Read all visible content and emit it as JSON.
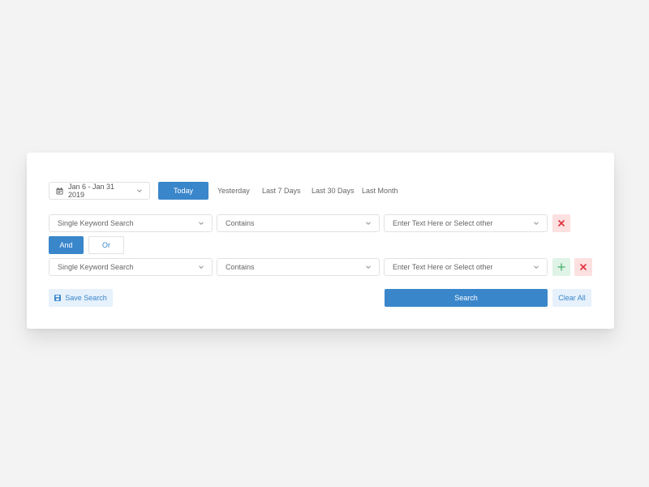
{
  "colors": {
    "accent": "#3a86cb",
    "accent_light": "#e6f1fb",
    "danger": "#e0303a",
    "danger_light": "#fde0e0",
    "success": "#46b06a",
    "success_light": "#dff3e6",
    "background": "#f3f3f3",
    "panel": "#ffffff"
  },
  "date_filter": {
    "range_label": "Jan 6 - Jan 31 2019",
    "icon": "calendar-icon",
    "quick_ranges": [
      {
        "label": "Today",
        "active": true
      },
      {
        "label": "Yesterday",
        "active": false
      },
      {
        "label": "Last 7 Days",
        "active": false
      },
      {
        "label": "Last 30 Days",
        "active": false
      },
      {
        "label": "Last Month",
        "active": false
      }
    ]
  },
  "conditions": [
    {
      "field": "Single Keyword Search",
      "operator": "Contains",
      "value_placeholder": "Enter Text Here or Select other",
      "actions": [
        "remove"
      ]
    },
    {
      "field": "Single Keyword Search",
      "operator": "Contains",
      "value_placeholder": "Enter Text Here or Select other",
      "actions": [
        "add",
        "remove"
      ]
    }
  ],
  "logic": {
    "and_label": "And",
    "or_label": "Or",
    "selected": "And"
  },
  "footer": {
    "save_label": "Save Search",
    "save_icon": "floppy-disk-icon",
    "search_label": "Search",
    "clear_label": "Clear All"
  }
}
